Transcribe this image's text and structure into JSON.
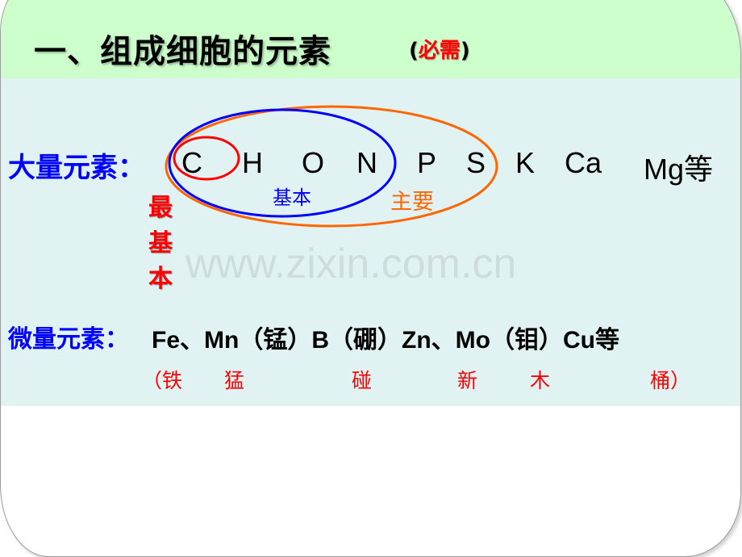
{
  "slide": {
    "title": "一、组成细胞的元素",
    "title_note": {
      "open": "(",
      "emphasis": "必需",
      "close": ")"
    },
    "macro": {
      "label": "大量元素：",
      "elements": [
        "C",
        "H",
        "O",
        "N",
        "P",
        "S",
        "K",
        "Ca",
        "Mg等"
      ],
      "groups": {
        "most_basic": {
          "label": "最基本",
          "members": [
            "C"
          ],
          "color": "#ff0000"
        },
        "basic": {
          "label": "基本",
          "members": [
            "C",
            "H",
            "O",
            "N"
          ],
          "color": "#0000ff"
        },
        "main": {
          "label": "主要",
          "members": [
            "C",
            "H",
            "O",
            "N",
            "P",
            "S"
          ],
          "color": "#ff6600"
        }
      }
    },
    "micro": {
      "label": "微量元素：",
      "list": "Fe、Mn（锰）B（硼）Zn、Mo（钼）Cu等",
      "mnemonic": [
        "（铁",
        "猛",
        "碰",
        "新",
        "木",
        "桶）"
      ]
    },
    "watermark": "www.zixin.com.cn"
  },
  "colors": {
    "title_band": "#ccffcc",
    "content_band": "#e1f2f2",
    "label_blue": "#0000ff",
    "accent_red": "#ff0000",
    "accent_orange": "#ff6600"
  }
}
